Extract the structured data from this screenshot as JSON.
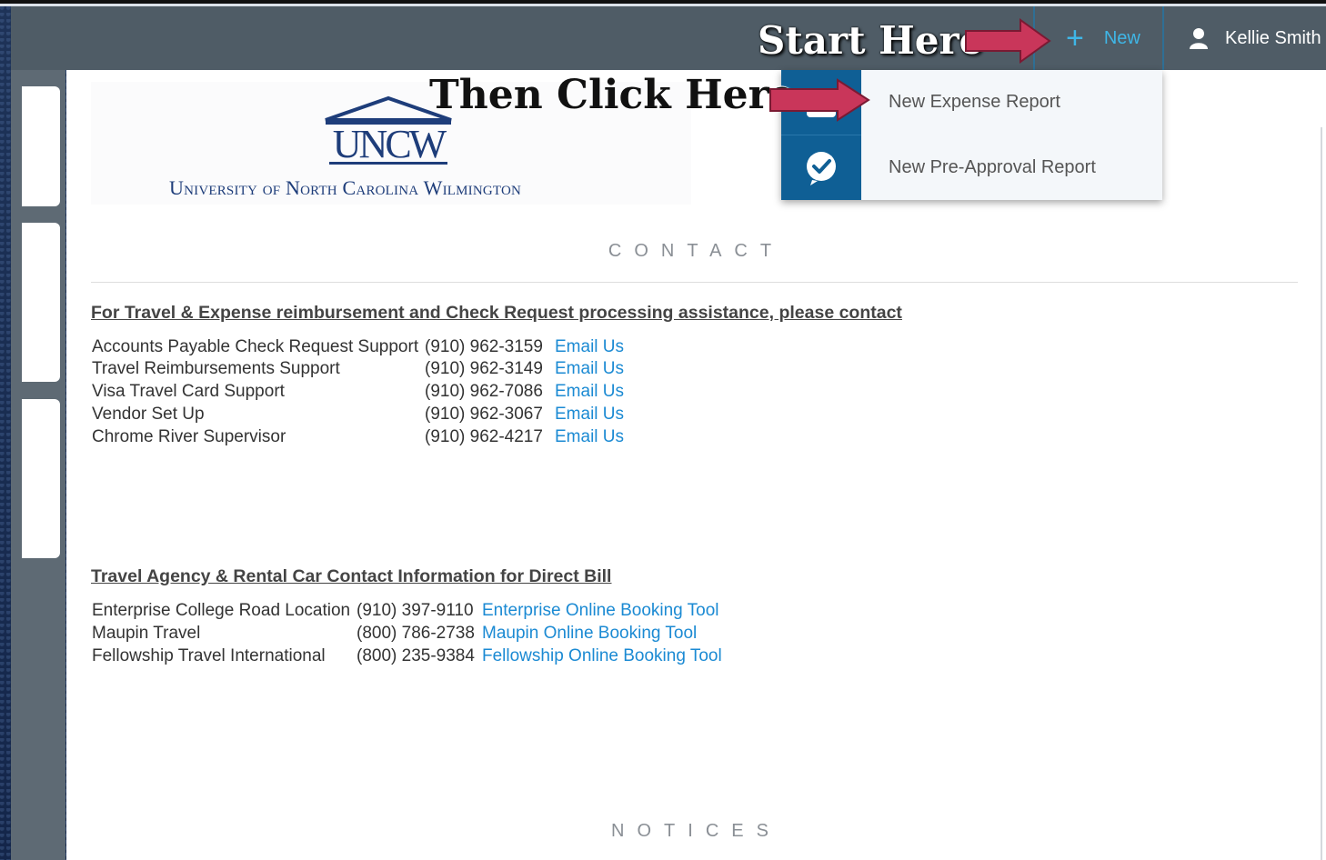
{
  "header": {
    "new_label": "New",
    "plus_symbol": "+",
    "user_name": "Kellie Smith"
  },
  "annotations": {
    "start": "Start Here",
    "then": "Then Click Here"
  },
  "dropdown": {
    "items": [
      {
        "label": "New Expense Report",
        "icon": "expense-report-icon"
      },
      {
        "label": "New Pre-Approval Report",
        "icon": "check-badge-icon"
      }
    ]
  },
  "logo": {
    "mark": "UNCW",
    "university_name": "University of North Carolina Wilmington"
  },
  "contact": {
    "title": "CONTACT",
    "heading": "For Travel & Expense reimbursement and Check Request processing assistance, please contact",
    "rows": [
      {
        "name": "Accounts Payable Check Request Support",
        "phone": "(910) 962-3159",
        "link": "Email Us"
      },
      {
        "name": "Travel Reimbursements Support",
        "phone": "(910) 962-3149",
        "link": "Email Us"
      },
      {
        "name": "Visa Travel Card Support",
        "phone": "(910) 962-7086",
        "link": "Email Us"
      },
      {
        "name": "Vendor Set Up",
        "phone": "(910) 962-3067",
        "link": "Email Us"
      },
      {
        "name": "Chrome River Supervisor",
        "phone": "(910) 962-4217",
        "link": "Email Us"
      }
    ]
  },
  "travel": {
    "heading": "Travel Agency & Rental Car Contact Information for Direct Bill",
    "rows": [
      {
        "name": "Enterprise College Road Location",
        "phone": "(910) 397-9110",
        "link": "Enterprise Online Booking Tool"
      },
      {
        "name": "Maupin Travel",
        "phone": "(800) 786-2738",
        "link": "Maupin Online Booking Tool"
      },
      {
        "name": "Fellowship Travel International",
        "phone": "(800) 235-9384",
        "link": "Fellowship Online Booking Tool"
      }
    ]
  },
  "notices": {
    "title": "NOTICES"
  },
  "colors": {
    "accent": "#3fb6e6",
    "dropdown_icon_bg": "#0f5f95",
    "link": "#1b8ad3",
    "header_bg": "#4f5c66",
    "arrow": "#c9365a"
  }
}
